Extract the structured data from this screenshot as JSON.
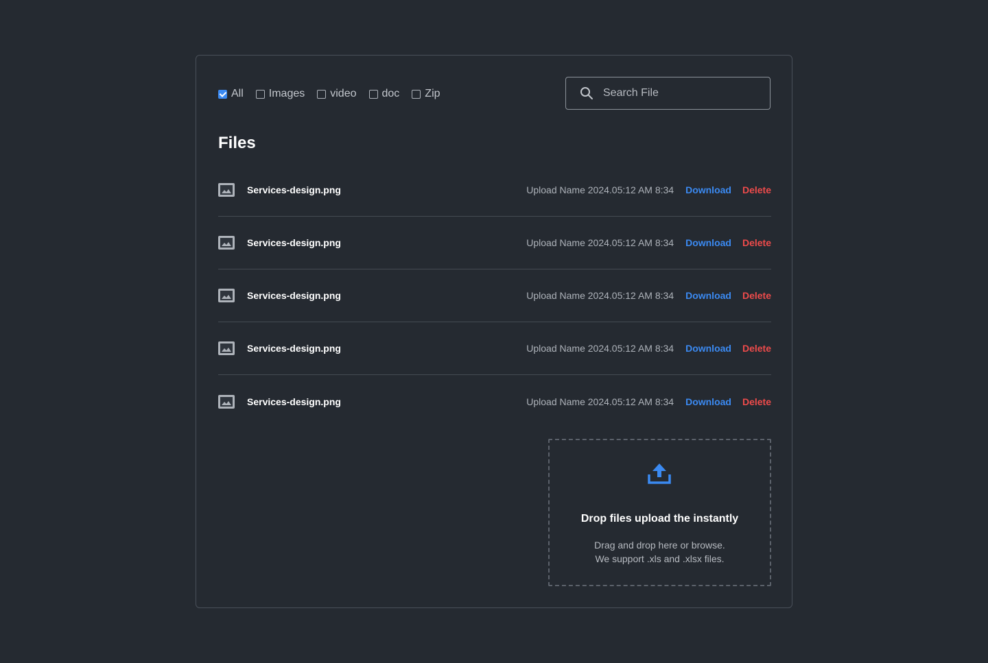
{
  "filters": [
    {
      "label": "All",
      "checked": true
    },
    {
      "label": "Images",
      "checked": false
    },
    {
      "label": "video",
      "checked": false
    },
    {
      "label": "doc",
      "checked": false
    },
    {
      "label": "Zip",
      "checked": false
    }
  ],
  "search": {
    "placeholder": "Search File",
    "icon": "search-icon"
  },
  "section_title": "Files",
  "files": [
    {
      "name": "Services-design.png",
      "meta": "Upload Name 2024.05:12 AM 8:34",
      "download": "Download",
      "delete": "Delete",
      "icon": "image-file-icon"
    },
    {
      "name": "Services-design.png",
      "meta": "Upload Name 2024.05:12 AM 8:34",
      "download": "Download",
      "delete": "Delete",
      "icon": "image-file-icon"
    },
    {
      "name": "Services-design.png",
      "meta": "Upload Name 2024.05:12 AM 8:34",
      "download": "Download",
      "delete": "Delete",
      "icon": "image-file-icon"
    },
    {
      "name": "Services-design.png",
      "meta": "Upload Name 2024.05:12 AM 8:34",
      "download": "Download",
      "delete": "Delete",
      "icon": "image-file-icon"
    },
    {
      "name": "Services-design.png",
      "meta": "Upload Name 2024.05:12 AM 8:34",
      "download": "Download",
      "delete": "Delete",
      "icon": "image-file-icon"
    }
  ],
  "dropzone": {
    "icon": "upload-icon",
    "title": "Drop files upload the instantly",
    "line1": "Drag and drop here or browse.",
    "line2": "We support .xls and .xlsx files."
  },
  "colors": {
    "background": "#252a31",
    "accent": "#3b8af2",
    "danger": "#ee4b4b",
    "border": "#4a5059"
  }
}
